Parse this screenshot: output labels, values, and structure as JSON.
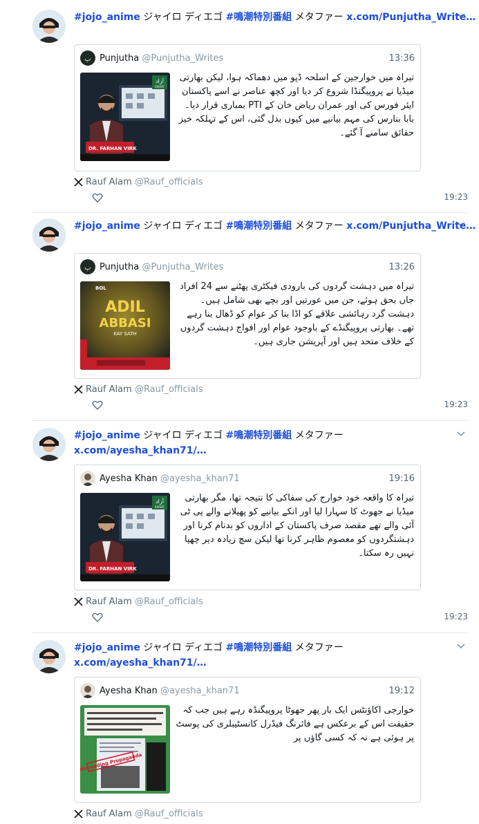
{
  "posts": [
    {
      "text": {
        "hashtag1": "#jojo_anime",
        "jp1": " ジャイロ ディエゴ ",
        "hashtag2": "#鳴潮特別番組",
        "jp2": " メタファー ",
        "link": "x.com/Punjutha_Write…"
      },
      "quote": {
        "name": "Punjutha",
        "handle": "@Punjutha_Writes",
        "time": "13:36",
        "body": "تیراہ میں خوارجین کے اسلحہ ڈپو میں دھماکہ ہوا، لیکن بھارتی میڈیا نے پروپیگنڈا شروع کر دیا اور کچھ عناصر نے اسے پاکستان ایئر فورس کی اور عمران ریاض خان کے PTI بمباری قرار دیا۔ بابا بنارس کی مہم بیانیے میں کیوں بدل گئی، اس کے تہلکہ خیز حقائق سامنے آ گئے۔",
        "thumb": {
          "kind": "studio",
          "badge": "DR. FARHAN VIRK",
          "logo": "آزاد",
          "logo_sub": "SIASAT"
        }
      },
      "via": {
        "name": "Rauf Alam",
        "handle": "@Rauf_officials"
      },
      "time": "19:23"
    },
    {
      "text": {
        "hashtag1": "#jojo_anime",
        "jp1": " ジャイロ ディエゴ ",
        "hashtag2": "#鳴潮特別番組",
        "jp2": " メタファー ",
        "link": "x.com/Punjutha_Write…"
      },
      "quote": {
        "name": "Punjutha",
        "handle": "@Punjutha_Writes",
        "time": "13:26",
        "body": "تیراہ میں دہشت گردوں کی بارودی فیکٹری پھٹنے سے 24 افراد جاں بحق ہوئے، جن میں عورتیں اور بچے بھی شامل ہیں۔ دہشت گرد رہائشی علاقے کو اڈا بنا کر عوام کو ڈھال بنا رہے تھے۔ بھارتی پروپیگنڈے کے باوجود عوام اور افواج دہشت گردوں کے خلاف متحد ہیں اور آپریشن جاری ہیں۔",
        "thumb": {
          "kind": "bol",
          "line1": "ADIL",
          "line2": "ABBASI",
          "line3": "KAY SATH",
          "brand": "BOL"
        }
      },
      "via": {
        "name": "Rauf Alam",
        "handle": "@Rauf_officials"
      },
      "time": "19:23"
    },
    {
      "text": {
        "hashtag1": "#jojo_anime",
        "jp1": " ジャイロ ディエゴ ",
        "hashtag2": "#鳴潮特別番組",
        "jp2": " メタファー ",
        "link": "x.com/ayesha_khan71/…"
      },
      "quote": {
        "name": "Ayesha Khan",
        "handle": "@ayesha_khan71",
        "time": "19:16",
        "body": "تیراہ کا واقعہ خود خوارج کی سفاکی کا نتیجہ تھا، مگر بھارتی میڈیا نے جھوٹ کا سہارا لیا اور انکے بیانیے کو پھیلانے والے پی ٹی آئی والے تھے مقصد صرف پاکستان کے اداروں کو بدنام کرنا اور دہشتگردوں کو معصوم ظاہر کرنا تھا لیکن سچ زیادہ دیر چھپا نہیں رہ سکتا۔",
        "thumb": {
          "kind": "studio",
          "badge": "DR. FARHAN VIRK",
          "logo": "آزاد",
          "logo_sub": "SIASAT"
        }
      },
      "via": {
        "name": "Rauf Alam",
        "handle": "@Rauf_officials"
      },
      "time": "19:23"
    },
    {
      "text": {
        "hashtag1": "#jojo_anime",
        "jp1": " ジャイロ ディエゴ ",
        "hashtag2": "#鳴潮特別番組",
        "jp2": " メタファー ",
        "link": "x.com/ayesha_khan71/…"
      },
      "quote": {
        "name": "Ayesha Khan",
        "handle": "@ayesha_khan71",
        "time": "19:12",
        "body": "خوارجی اکاؤنٹس ایک بار پھر جھوٹا پروپیگنڈہ رہے ہیں جب کہ حقیقت اس کے برعکس ہے فائرنگ فیڈرل کانسٹیبلری کی پوسٹ پر ہوئی ہے نہ کہ کسی گاؤں پر",
        "thumb": {
          "kind": "doc",
          "stamp": "Misleading Propaganda"
        }
      },
      "via": {
        "name": "Rauf Alam",
        "handle": "@Rauf_officials"
      }
    }
  ],
  "colors": {
    "accent": "#1d4ed8",
    "muted": "#536471",
    "border": "#cfd9de"
  }
}
